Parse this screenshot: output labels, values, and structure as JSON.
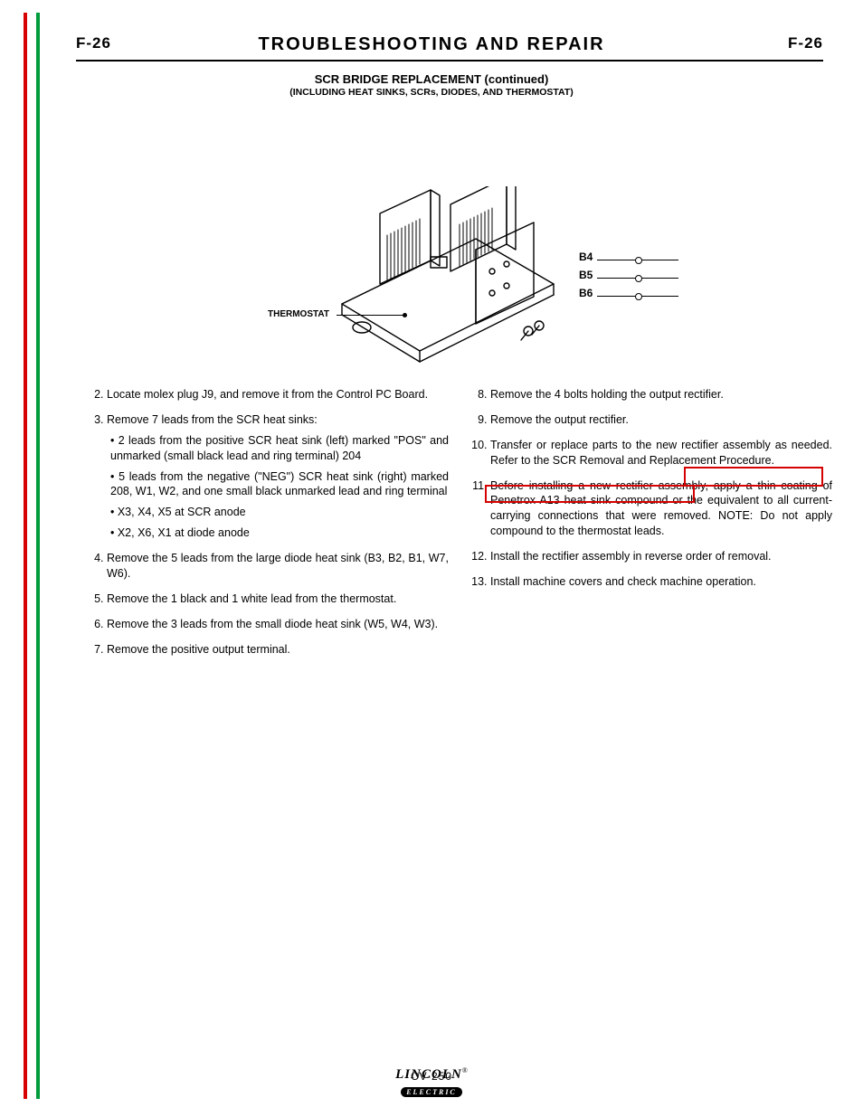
{
  "header": {
    "page_left": "F-26",
    "title": "TROUBLESHOOTING AND REPAIR",
    "page_right": "F-26"
  },
  "figure": {
    "title": "SCR BRIDGE REPLACEMENT (continued)",
    "subtitle": "(INCLUDING HEAT SINKS, SCRs, DIODES, AND THERMOSTAT)",
    "callout_label": "THERMOSTAT",
    "leads": [
      "B4",
      "B5",
      "B6"
    ]
  },
  "steps_left": [
    "Locate molex plug J9, and remove it from the Control PC Board.",
    "Remove 7 leads from the SCR heat sinks:",
    "Remove the 5 leads from the large diode heat sink (B3, B2, B1, W7, W6).",
    "Remove the 1 black and 1 white lead from the thermostat.",
    "Remove the 3 leads from the small diode heat sink (W5, W4, W3).",
    "Remove the positive output terminal."
  ],
  "sub_left": {
    "a": "• 2 leads from the positive SCR heat sink (left) marked \"POS\" and unmarked (small black lead and ring terminal) 204",
    "b": "• 5 leads from the negative (\"NEG\") SCR heat sink (right) marked 208, W1, W2, and one small black unmarked lead and ring terminal",
    "c": "• X3, X4, X5 at SCR anode",
    "d": "• X2, X6, X1 at diode anode"
  },
  "steps_right": [
    "Remove the 4 bolts holding the output rectifier.",
    "Remove the output rectifier.",
    "Transfer or replace parts to the new rectifier assembly as needed. Refer to the SCR Removal and Replacement Procedure.",
    "Before installing a new rectifier assembly, apply a thin coating of Penetrox A13 heat sink compound or the equivalent to all current-carrying connections that were removed. NOTE: Do not apply compound to the thermostat leads.",
    "Install the rectifier assembly in reverse order of removal.",
    "Install machine covers and check machine operation."
  ],
  "footer": {
    "model": "CV-250",
    "logo_top": "LINCOLN",
    "logo_bot": "ELECTRIC"
  }
}
